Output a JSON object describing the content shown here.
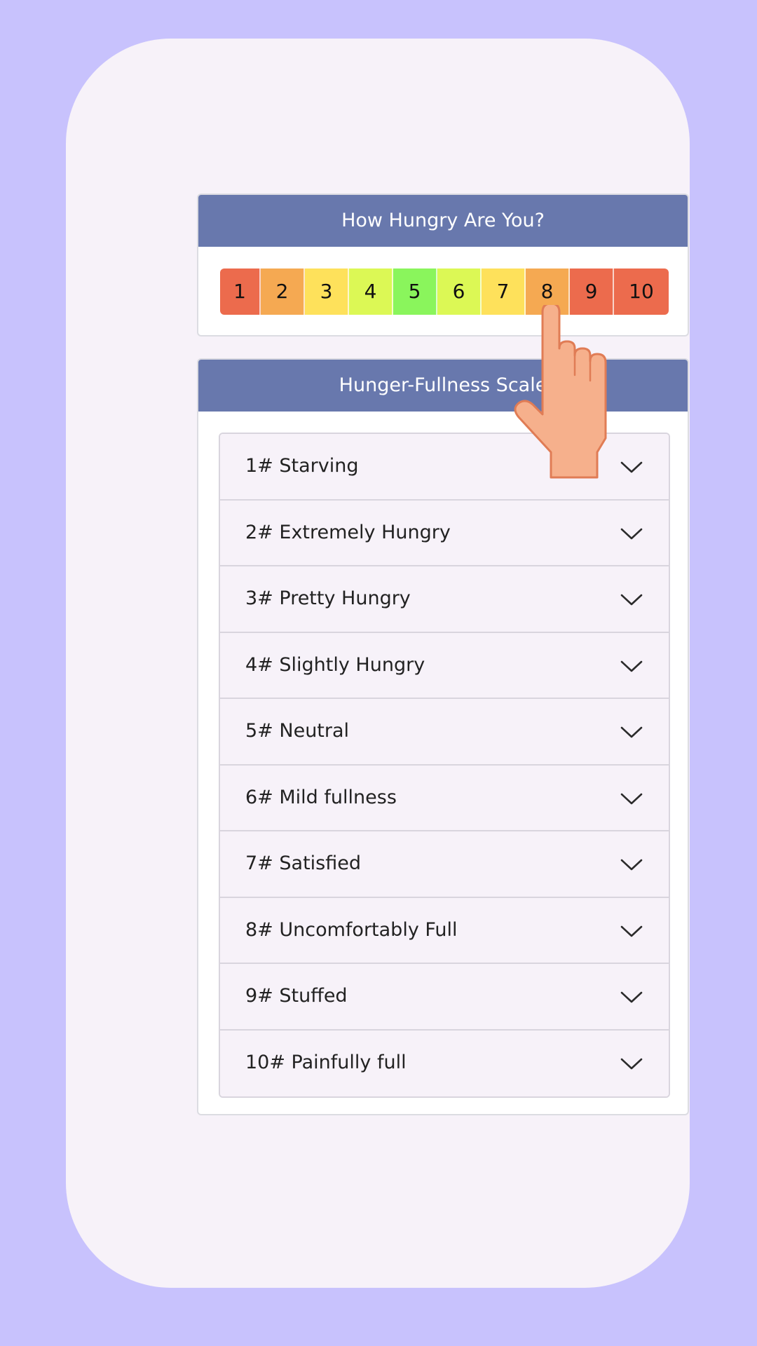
{
  "rating_card": {
    "title": "How Hungry Are You?",
    "scale": [
      {
        "label": "1",
        "color": "#ec6b4d"
      },
      {
        "label": "2",
        "color": "#f5a952"
      },
      {
        "label": "3",
        "color": "#fee15b"
      },
      {
        "label": "4",
        "color": "#dcf855"
      },
      {
        "label": "5",
        "color": "#8af55c"
      },
      {
        "label": "6",
        "color": "#dcf855"
      },
      {
        "label": "7",
        "color": "#fee15b"
      },
      {
        "label": "8",
        "color": "#f5a952"
      },
      {
        "label": "9",
        "color": "#ec6b4d"
      },
      {
        "label": "10",
        "color": "#ec6b4d"
      }
    ]
  },
  "scale_card": {
    "title": "Hunger-Fullness Scale",
    "items": [
      {
        "label": "1# Starving"
      },
      {
        "label": "2# Extremely Hungry"
      },
      {
        "label": "3# Pretty Hungry"
      },
      {
        "label": "4# Slightly Hungry"
      },
      {
        "label": "5# Neutral"
      },
      {
        "label": "6# Mild fullness"
      },
      {
        "label": "7# Satisfied"
      },
      {
        "label": "8# Uncomfortably Full"
      },
      {
        "label": "9# Stuffed"
      },
      {
        "label": "10# Painfully full"
      }
    ]
  },
  "colors": {
    "background": "#c8c2fd",
    "phone": "#f7f2f9",
    "header": "#6878ad"
  },
  "icons": {
    "pointer": "pointing-hand-icon",
    "chevron": "chevron-down-icon"
  }
}
